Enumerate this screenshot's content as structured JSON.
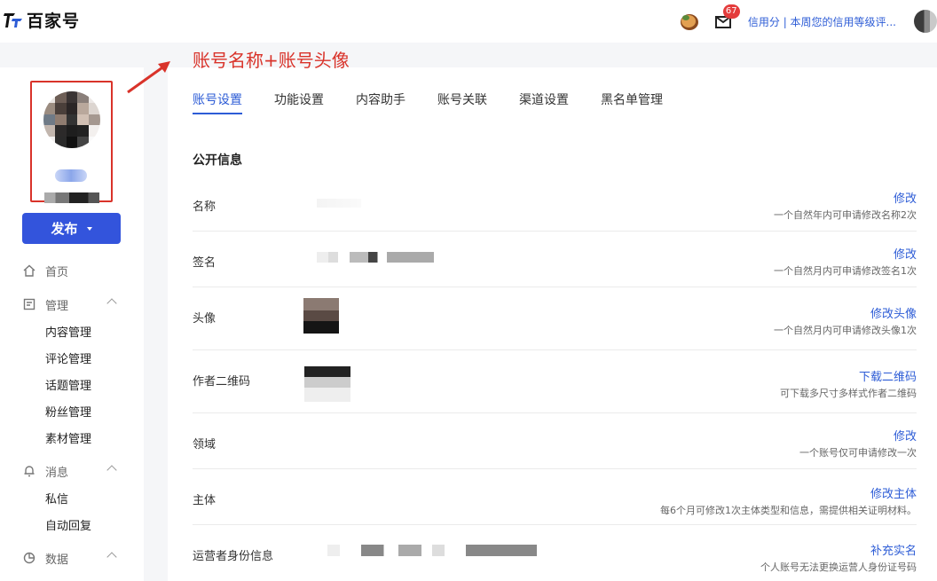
{
  "header": {
    "logo_text": "百家号",
    "mail_badge": "67",
    "credit_text": "信用分 | 本周您的信用等级评..."
  },
  "annotation": {
    "text": "账号名称+账号头像",
    "color": "#d9332a"
  },
  "sidebar": {
    "publish_label": "发布",
    "nav": {
      "home": "首页",
      "manage": "管理",
      "manage_items": [
        "内容管理",
        "评论管理",
        "话题管理",
        "粉丝管理",
        "素材管理"
      ],
      "message": "消息",
      "message_items": [
        "私信",
        "自动回复"
      ],
      "data": "数据"
    }
  },
  "tabs": [
    "账号设置",
    "功能设置",
    "内容助手",
    "账号关联",
    "渠道设置",
    "黑名单管理"
  ],
  "section_title": "公开信息",
  "rows": [
    {
      "label": "名称",
      "action": "修改",
      "hint": "一个自然年内可申请修改名称2次"
    },
    {
      "label": "签名",
      "action": "修改",
      "hint": "一个自然月内可申请修改签名1次"
    },
    {
      "label": "头像",
      "action": "修改头像",
      "hint": "一个自然月内可申请修改头像1次"
    },
    {
      "label": "作者二维码",
      "action": "下载二维码",
      "hint": "可下载多尺寸多样式作者二维码"
    },
    {
      "label": "领域",
      "action": "修改",
      "hint": "一个账号仅可申请修改一次"
    },
    {
      "label": "主体",
      "action": "修改主体",
      "hint": "每6个月可修改1次主体类型和信息，需提供相关证明材料。"
    },
    {
      "label": "运营者身份信息",
      "action": "补充实名",
      "hint": "个人账号无法更换运营人身份证号码"
    }
  ],
  "colors": {
    "accent": "#2d5cd6",
    "publish_button": "#3354dc",
    "annotation": "#d9332a"
  }
}
